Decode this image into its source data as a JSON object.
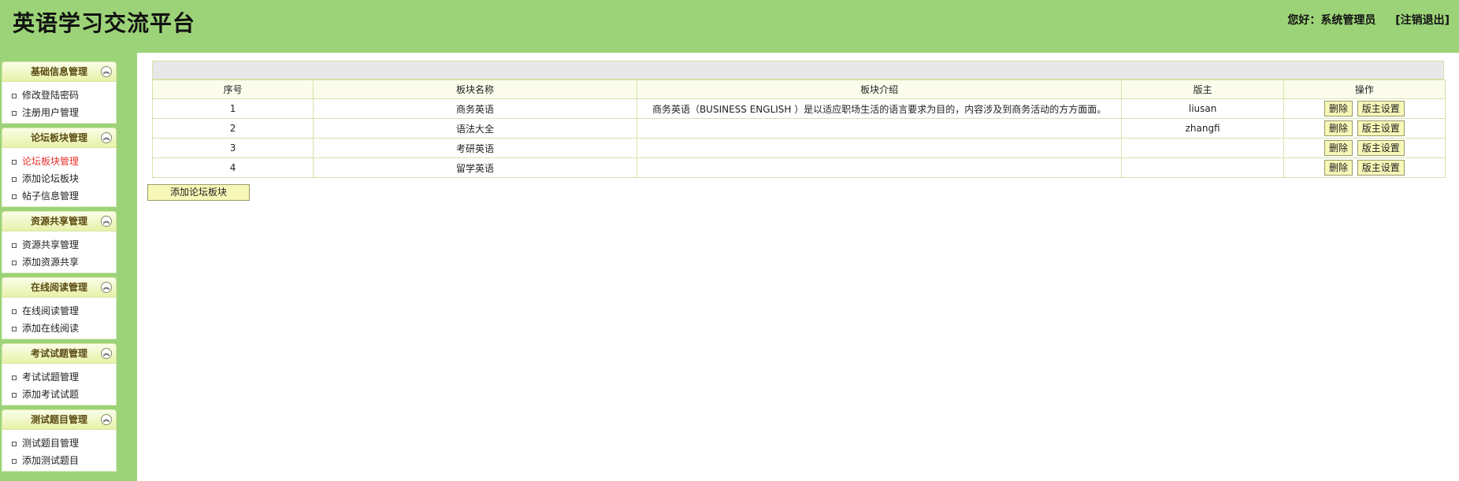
{
  "header": {
    "title": "英语学习交流平台",
    "greeting": "您好：系统管理员",
    "logout_label": "[注销退出]"
  },
  "sidebar": {
    "groups": [
      {
        "title": "基础信息管理",
        "items": [
          "修改登陆密码",
          "注册用户管理"
        ]
      },
      {
        "title": "论坛板块管理",
        "items": [
          "论坛板块管理",
          "添加论坛板块",
          "帖子信息管理"
        ]
      },
      {
        "title": "资源共享管理",
        "items": [
          "资源共享管理",
          "添加资源共享"
        ]
      },
      {
        "title": "在线阅读管理",
        "items": [
          "在线阅读管理",
          "添加在线阅读"
        ]
      },
      {
        "title": "考试试题管理",
        "items": [
          "考试试题管理",
          "添加考试试题"
        ]
      },
      {
        "title": "测试题目管理",
        "items": [
          "测试题目管理",
          "添加测试题目"
        ]
      }
    ],
    "active_item": "论坛板块管理"
  },
  "table": {
    "headers": [
      "序号",
      "板块名称",
      "板块介绍",
      "版主",
      "操作"
    ],
    "rows": [
      {
        "no": "1",
        "name": "商务英语",
        "intro": "商务英语（BUSINESS ENGLISH ）是以适应职场生活的语言要求为目的，内容涉及到商务活动的方方面面。",
        "moderator": "liusan"
      },
      {
        "no": "2",
        "name": "语法大全",
        "intro": "",
        "moderator": "zhangfi"
      },
      {
        "no": "3",
        "name": "考研英语",
        "intro": "",
        "moderator": ""
      },
      {
        "no": "4",
        "name": "留学英语",
        "intro": "",
        "moderator": ""
      }
    ],
    "delete_label": "删除",
    "set_moderator_label": "版主设置"
  },
  "add_board_label": "添加论坛板块",
  "colors": {
    "header_bg": "#9cd378",
    "active_link": "#e8302b",
    "button_bg": "#f7f7b8"
  }
}
